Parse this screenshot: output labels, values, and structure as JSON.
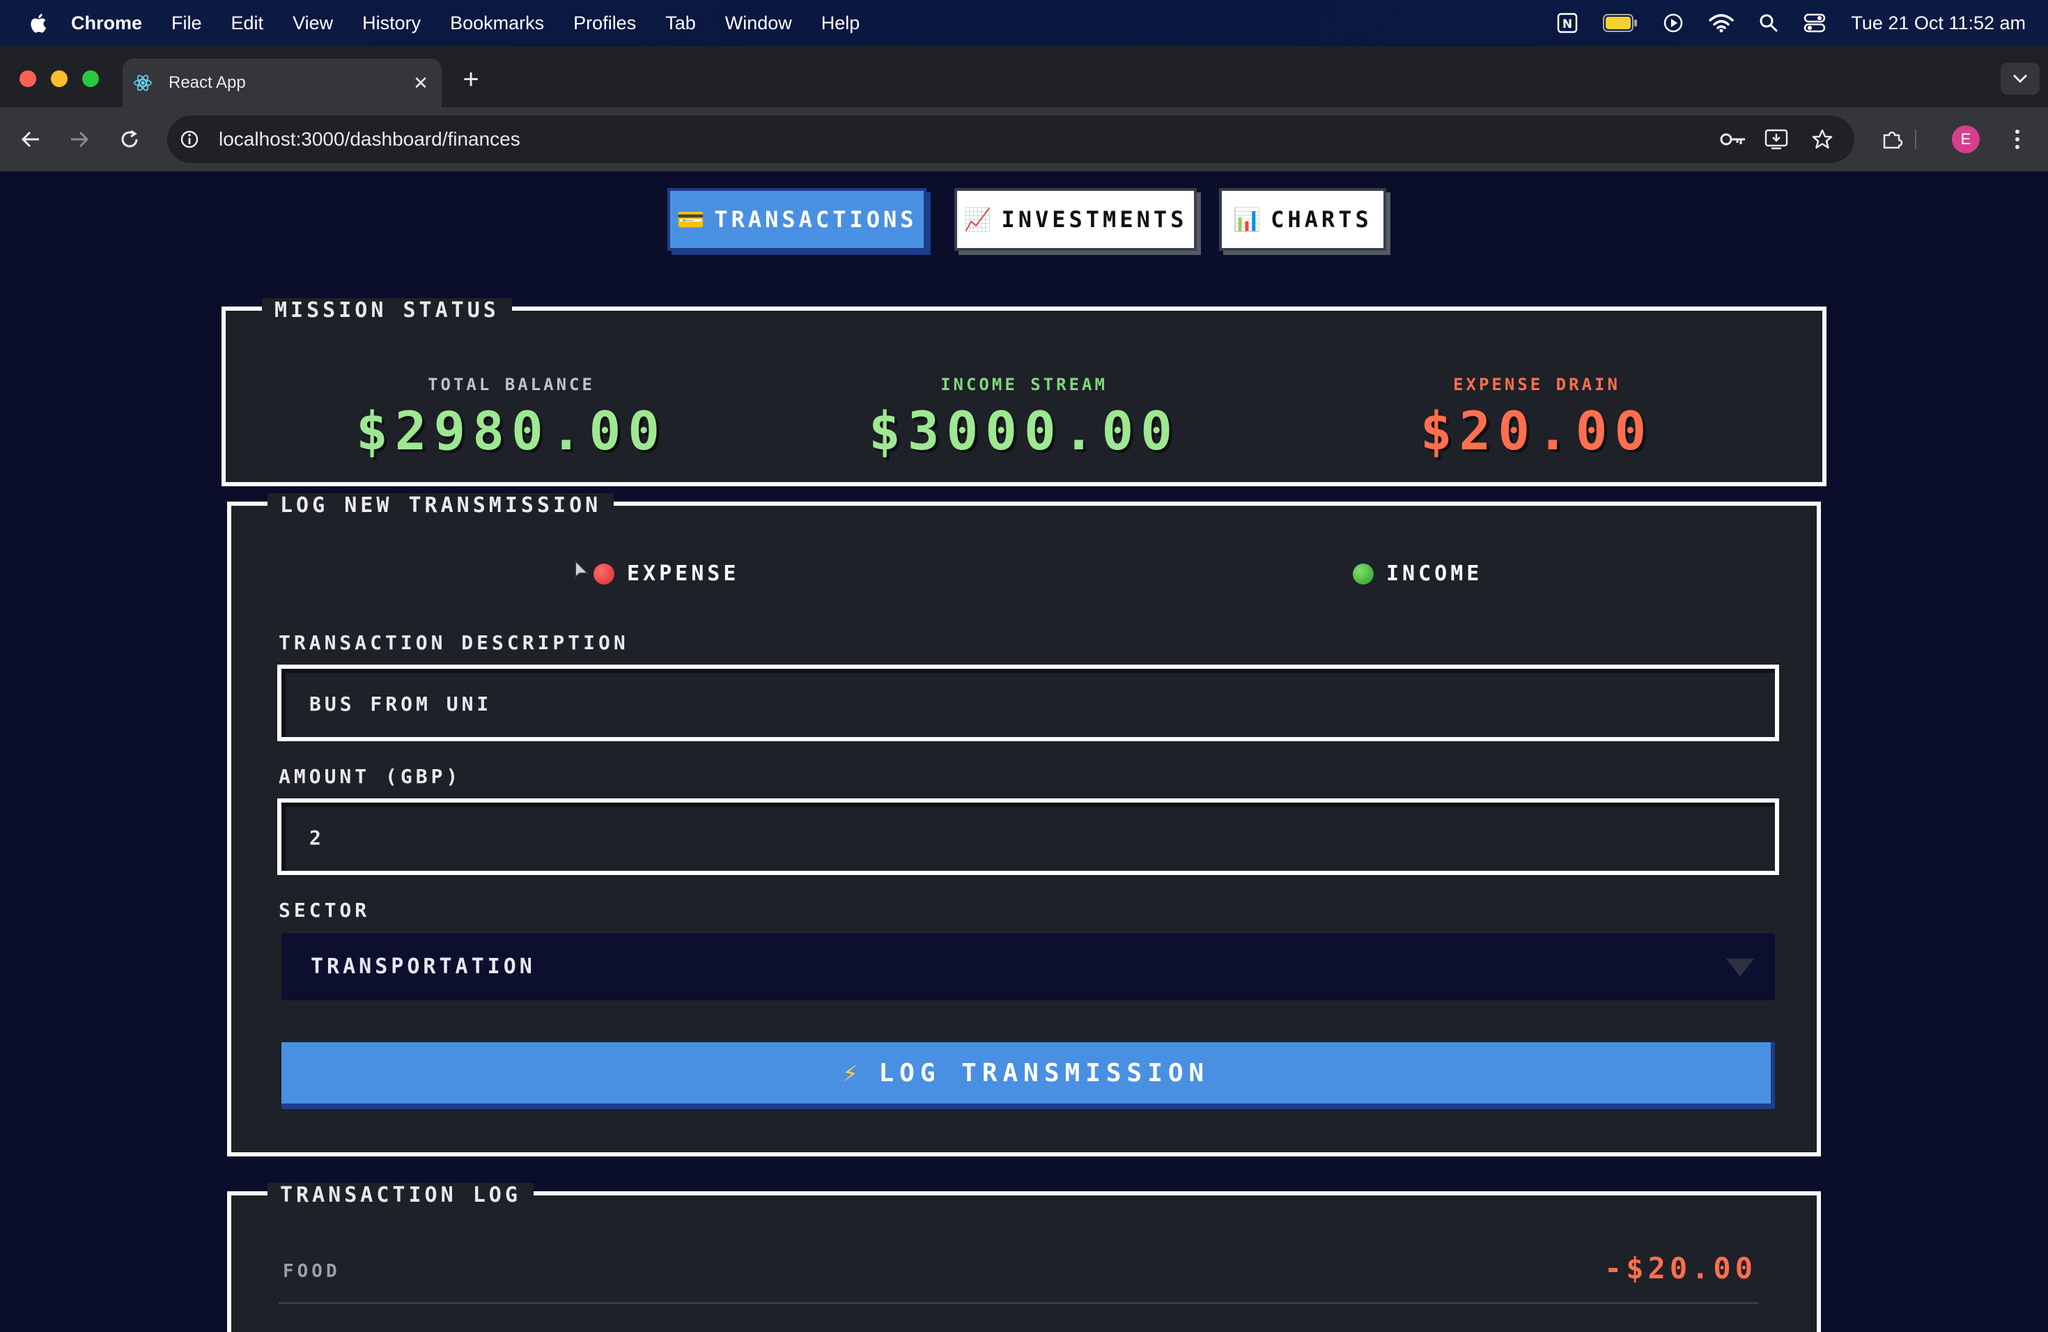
{
  "menubar": {
    "app": "Chrome",
    "items": [
      "File",
      "Edit",
      "View",
      "History",
      "Bookmarks",
      "Profiles",
      "Tab",
      "Window",
      "Help"
    ],
    "clock": "Tue 21 Oct  11:52 am"
  },
  "browser": {
    "tab_title": "React App",
    "url": "localhost:3000/dashboard/finances",
    "profile_initial": "E"
  },
  "nav": {
    "transactions": "TRANSACTIONS",
    "investments": "INVESTMENTS",
    "charts": "CHARTS",
    "active": "transactions"
  },
  "mission": {
    "title": "MISSION STATUS",
    "total_label": "TOTAL BALANCE",
    "total_value": "$2980.00",
    "income_label": "INCOME STREAM",
    "income_value": "$3000.00",
    "expense_label": "EXPENSE DRAIN",
    "expense_value": "$20.00"
  },
  "form": {
    "title": "LOG NEW TRANSMISSION",
    "type_expense": "EXPENSE",
    "type_income": "INCOME",
    "selected_type": "expense",
    "desc_label": "TRANSACTION DESCRIPTION",
    "desc_value": "BUS FROM UNI",
    "amount_label": "AMOUNT (GBP)",
    "amount_value": "2",
    "sector_label": "SECTOR",
    "sector_value": "TRANSPORTATION",
    "submit_label": "LOG TRANSMISSION"
  },
  "log": {
    "title": "TRANSACTION LOG",
    "rows": [
      {
        "category": "FOOD",
        "amount": "-$20.00"
      }
    ]
  },
  "colors": {
    "accent": "#4a90e2",
    "income": "#8ee08a",
    "expense": "#ff6f4e",
    "balance": "#9ee891"
  }
}
